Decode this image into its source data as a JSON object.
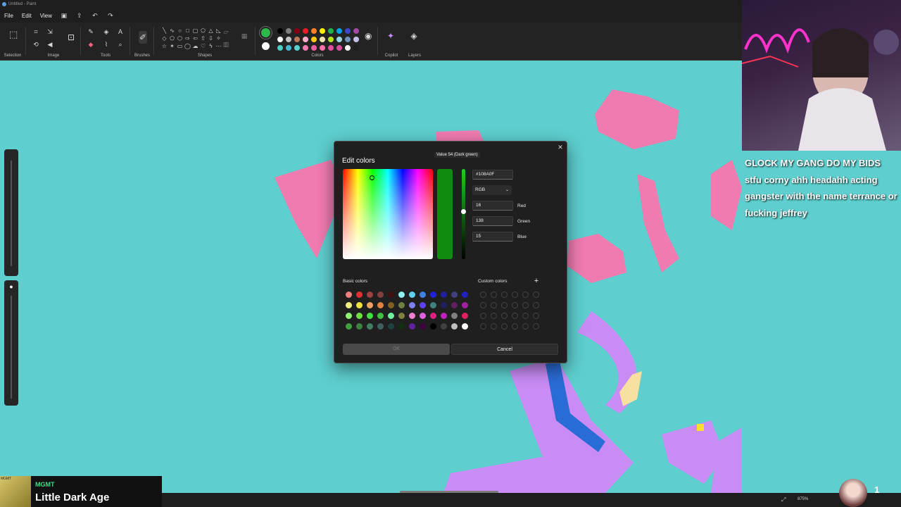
{
  "window": {
    "title": "Untitled - Paint"
  },
  "menu": {
    "file": "File",
    "edit": "Edit",
    "view": "View"
  },
  "ribbon": {
    "groups": [
      "Selection",
      "Image",
      "Tools",
      "Brushes",
      "Shapes",
      "Colors",
      "Copilot",
      "Layers"
    ],
    "primary_color": "#2eb84a",
    "secondary_color": "#ffffff",
    "palette": [
      "#000000",
      "#7f7f7f",
      "#880015",
      "#ed1c24",
      "#ff7f27",
      "#fff200",
      "#22b14c",
      "#00a2e8",
      "#3f48cc",
      "#a349a4",
      "#ffffff",
      "#c3c3c3",
      "#b97a57",
      "#ffaec9",
      "#ffc90e",
      "#efe4b0",
      "#b5e61d",
      "#99d9ea",
      "#7092be",
      "#c8bfe7",
      "#4ecdc4",
      "#45b7d1",
      "#5ad1d1",
      "#f07bb0",
      "#ec5ea0",
      "#ff6fa8",
      "#e24fa0",
      "#d64ea0",
      "#f5f5f5",
      "#1e1e1e"
    ]
  },
  "dialog": {
    "title": "Edit colors",
    "tooltip": "Value 54 (Dark green)",
    "hex": "#108A0F",
    "mode": "RGB",
    "red": "16",
    "green": "138",
    "blue": "15",
    "red_label": "Red",
    "green_label": "Green",
    "blue_label": "Blue",
    "basic_label": "Basic colors",
    "custom_label": "Custom colors",
    "ok": "OK",
    "cancel": "Cancel",
    "current_color": "#108a0f",
    "basic_colors": [
      "#f08080",
      "#e03030",
      "#a04040",
      "#804040",
      "#401010",
      "#90f0f0",
      "#60d0f0",
      "#4080e0",
      "#2020e0",
      "#2020a0",
      "#404080",
      "#2020c0",
      "#f0f080",
      "#f0e040",
      "#f0a060",
      "#e08040",
      "#806020",
      "#708040",
      "#8080f0",
      "#6040f0",
      "#408080",
      "#202060",
      "#602060",
      "#a020a0",
      "#90f070",
      "#70e040",
      "#40e040",
      "#40c040",
      "#70f0a0",
      "#808040",
      "#f080d0",
      "#e060e0",
      "#e02080",
      "#c020c0",
      "#808080",
      "#e02060",
      "#40a040",
      "#408040",
      "#408060",
      "#406060",
      "#204040",
      "#103010",
      "#6020a0",
      "#400040",
      "#000000",
      "#404040",
      "#c0c0c0",
      "#ffffff"
    ]
  },
  "chat": {
    "message": "GLOCK MY GANG DO MY BIDS stfu corny ahh headahh acting gangster with the name terrance or fucking jeffrey"
  },
  "now_playing": {
    "album_tag": "MGMT",
    "artist": "MGMT",
    "song": "Little Dark Age"
  },
  "status": {
    "zoom": "875%",
    "viewer_count": "1"
  }
}
